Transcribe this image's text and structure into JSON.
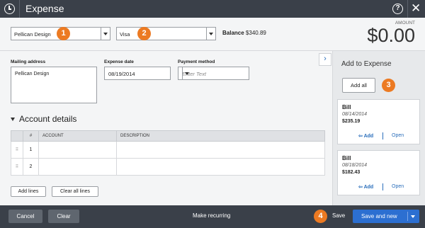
{
  "window": {
    "title": "Expense"
  },
  "header": {
    "payee": "Pellican Design",
    "account": "Visa",
    "balance_label": "Balance",
    "balance_value": "$340.89",
    "amount_label": "AMOUNT",
    "amount_value": "$0.00"
  },
  "badges": [
    "1",
    "2",
    "3",
    "4"
  ],
  "form": {
    "mailing_label": "Mailing address",
    "mailing_value": "Pellican Design",
    "date_label": "Expense date",
    "date_value": "08/19/2014",
    "payment_label": "Payment method",
    "payment_placeholder": "Enter Text"
  },
  "account_details": {
    "title": "Account details",
    "columns": [
      "#",
      "ACCOUNT",
      "DESCRIPTION"
    ],
    "rows": [
      {
        "num": "1"
      },
      {
        "num": "2"
      }
    ],
    "add_lines": "Add lines",
    "clear_all": "Clear all lines"
  },
  "sidebar": {
    "title": "Add to Expense",
    "add_all": "Add all",
    "cards": [
      {
        "title": "Bill",
        "date": "08/14/2014",
        "amount": "$235.19",
        "add": "Add",
        "open": "Open"
      },
      {
        "title": "Bill",
        "date": "08/18/2014",
        "amount": "$182.43",
        "add": "Add",
        "open": "Open"
      }
    ]
  },
  "footer": {
    "cancel": "Cancel",
    "clear": "Clear",
    "recurring": "Make recurring",
    "save": "Save",
    "save_new": "Save and new"
  },
  "colors": {
    "accent": "#2c6fd1",
    "badge": "#ec7a22",
    "bar": "#3a4049"
  },
  "icons": [
    "clock-icon",
    "help-icon",
    "close-icon",
    "chevron-right-icon",
    "dropdown-arrow-icon",
    "drag-handle-icon",
    "add-arrow-icon"
  ]
}
